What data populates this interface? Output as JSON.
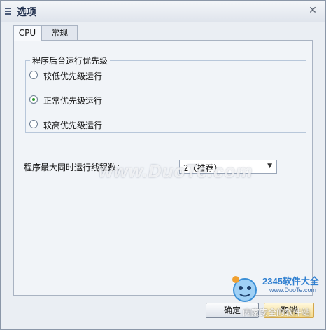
{
  "window": {
    "title": "选项"
  },
  "tabs": [
    {
      "label": "CPU",
      "active": true
    },
    {
      "label": "常规",
      "active": false
    }
  ],
  "priority_group": {
    "legend": "程序后台运行优先级",
    "options": [
      {
        "label": "较低优先级运行",
        "checked": false
      },
      {
        "label": "正常优先级运行",
        "checked": true
      },
      {
        "label": "较高优先级运行",
        "checked": false
      }
    ]
  },
  "threads": {
    "label": "程序最大同时运行线程数：",
    "selected": "2（推荐）"
  },
  "buttons": {
    "ok": "确定",
    "cancel": "取消"
  },
  "watermark": "www.DuoTe.com",
  "corner_logo": {
    "brand": "2345软件大全",
    "site": "www.DuoTe.com",
    "tag": "内家安全的软件站"
  },
  "colors": {
    "accent_check": "#2e9b2e",
    "titlebar": "#dfe4ec",
    "panel": "#f1f4f8"
  }
}
